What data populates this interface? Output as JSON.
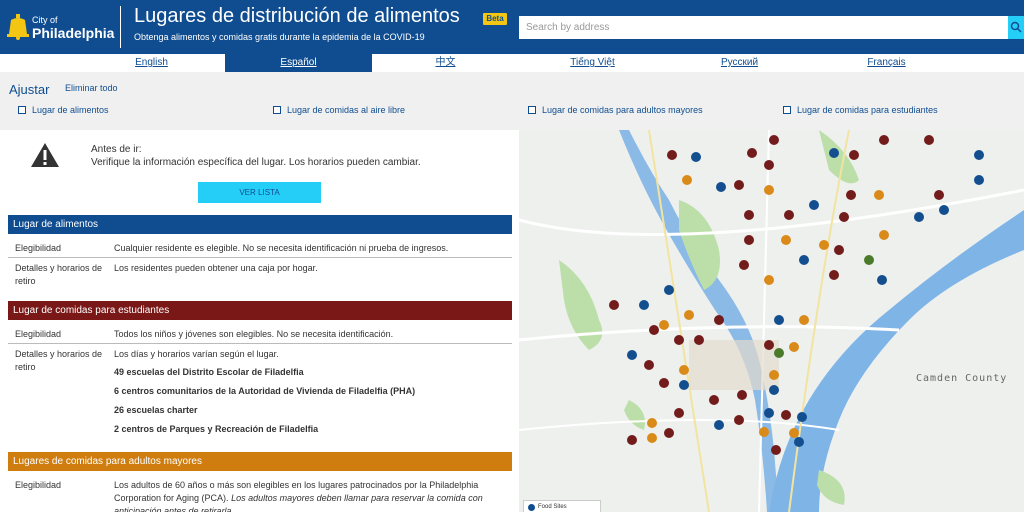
{
  "header": {
    "logo_small": "City of",
    "logo_big": "Philadelphia",
    "title": "Lugares de distribución de alimentos",
    "badge": "Beta",
    "subtitle": "Obtenga alimentos y comidas gratis durante la epidemia de la COVID-19",
    "search_placeholder": "Search by address"
  },
  "languages": [
    {
      "label": "English",
      "active": false
    },
    {
      "label": "Español",
      "active": true
    },
    {
      "label": "中文",
      "active": false
    },
    {
      "label": "Tiếng Việt",
      "active": false
    },
    {
      "label": "Русский",
      "active": false
    },
    {
      "label": "Français",
      "active": false
    }
  ],
  "filters": {
    "title": "Ajustar",
    "clear": "Eliminar todo",
    "items": [
      "Lugar de alimentos",
      "Lugar de comidas al aire libre",
      "Lugar de comidas para adultos mayores",
      "Lugar de comidas para estudiantes"
    ]
  },
  "notice": {
    "title": "Antes de ir:",
    "text": "Verifique la información específica del lugar. Los horarios pueden cambiar.",
    "button": "VER LISTA"
  },
  "sections": [
    {
      "title": "Lugar de alimentos",
      "color": "#0f4d90",
      "rows": [
        {
          "label": "Elegibilidad",
          "value": "Cualquier residente es elegible. No se necesita identificación ni prueba de ingresos."
        },
        {
          "label": "Detalles y horarios de retiro",
          "value": "Los residentes pueden obtener una caja por hogar."
        }
      ]
    },
    {
      "title": "Lugar de comidas para estudiantes",
      "color": "#7a1818",
      "rows": [
        {
          "label": "Elegibilidad",
          "value": "Todos los niños y jóvenes son elegibles. No se necesita identificación."
        },
        {
          "label": "Detalles y horarios de retiro",
          "value": "Los días y horarios varían según el lugar.",
          "items": [
            "49 escuelas del Distrito Escolar de Filadelfia",
            "6 centros comunitarios de la Autoridad de Vivienda de Filadelfia (PHA)",
            "26 escuelas charter",
            "2 centros de Parques y Recreación de Filadelfia"
          ]
        }
      ]
    },
    {
      "title": "Lugares de comidas para adultos mayores",
      "color": "#cf7d0f",
      "rows": [
        {
          "label": "Elegibilidad",
          "value": "Los adultos de 60 años o más son elegibles en los lugares patrocinados por la Philadelphia Corporation for Aging (PCA).",
          "value_italic": "Los adultos mayores deben llamar para reservar la comida con anticipación antes de retirarla."
        }
      ]
    }
  ],
  "map": {
    "label": "Camden County",
    "legend": "Food Sites",
    "colors": {
      "food": "#134e8f",
      "student": "#731c1c",
      "senior": "#d98a19",
      "outdoor": "#4a7a2a"
    }
  }
}
